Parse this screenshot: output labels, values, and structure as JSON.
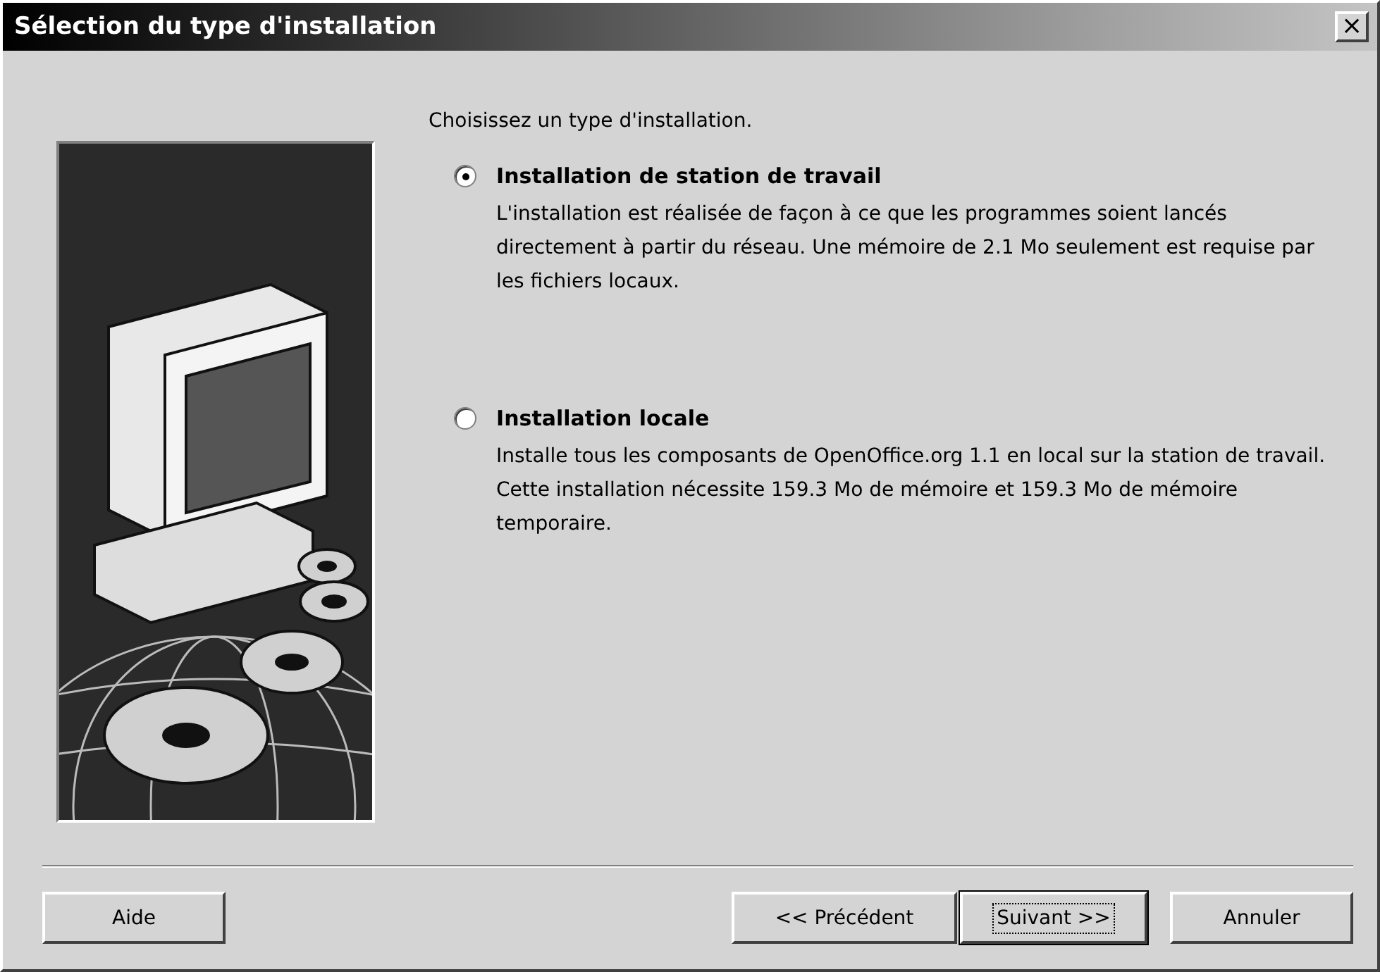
{
  "window": {
    "title": "Sélection du type d'installation",
    "close": "×"
  },
  "prompt": "Choisissez un type d'installation.",
  "options": [
    {
      "label": "Installation de station de travail",
      "selected": true,
      "description": "L'installation est réalisée de façon à ce que les programmes soient lancés directement à partir du réseau. Une mémoire de 2.1 Mo seulement est requise par les fichiers locaux."
    },
    {
      "label": "Installation locale",
      "selected": false,
      "description": "Installe tous les composants de OpenOffice.org 1.1 en local sur la station de travail. Cette installation nécessite 159.3 Mo de mémoire et 159.3 Mo de mémoire temporaire."
    }
  ],
  "buttons": [
    {
      "label": "Aide",
      "default": false
    },
    {
      "label": "<< Précédent",
      "default": false
    },
    {
      "label": "Suivant >>",
      "default": true
    },
    {
      "label": "Annuler",
      "default": false
    }
  ]
}
